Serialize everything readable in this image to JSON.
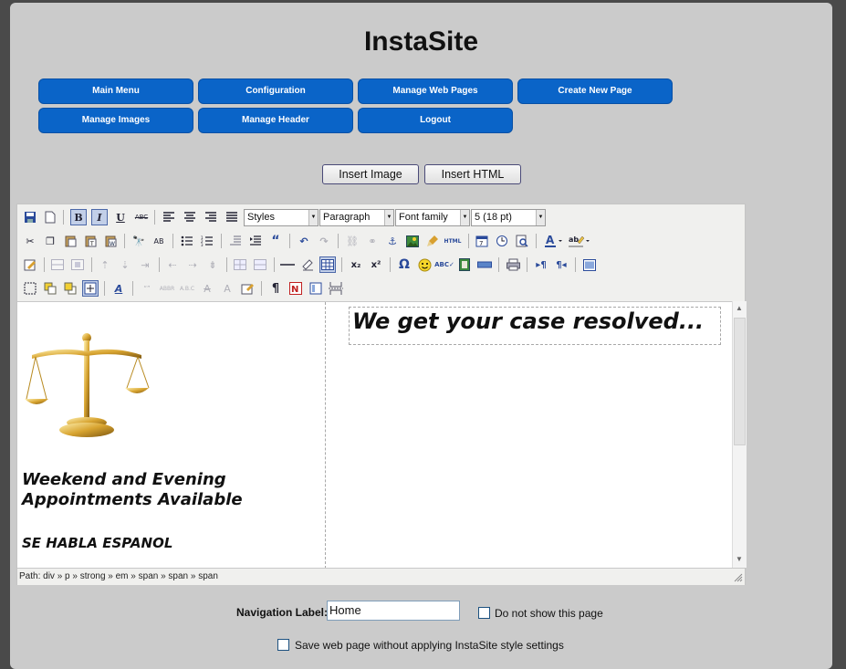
{
  "app": {
    "title": "InstaSite"
  },
  "nav": {
    "main_menu": "Main Menu",
    "configuration": "Configuration",
    "manage_web_pages": "Manage Web Pages",
    "create_new_page": "Create New Page",
    "manage_images": "Manage Images",
    "manage_header": "Manage Header",
    "logout": "Logout"
  },
  "actions": {
    "insert_image": "Insert Image",
    "insert_html": "Insert HTML"
  },
  "toolbar": {
    "bold": "B",
    "italic": "I",
    "underline": "U",
    "strike": "ABC",
    "styles": "Styles",
    "format": "Paragraph",
    "font_family": "Font family",
    "font_size": "5 (18 pt)"
  },
  "content": {
    "headline": "We get your case resolved...",
    "promo_line1": "Weekend and Evening",
    "promo_line2": "Appointments Available",
    "promo_spanish": "SE HABLA ESPANOL"
  },
  "status": {
    "path": "Path: div » p » strong » em » span » span » span"
  },
  "form": {
    "nav_label": "Navigation Label:",
    "nav_value": "Home",
    "hide_page_label": "Do not show this page",
    "no_style_label": "Save web page without applying InstaSite style settings"
  },
  "colors": {
    "nav_button": "#0a64c8",
    "page_bg": "#cbcbcb",
    "outer_bg": "#4a4a4a"
  }
}
